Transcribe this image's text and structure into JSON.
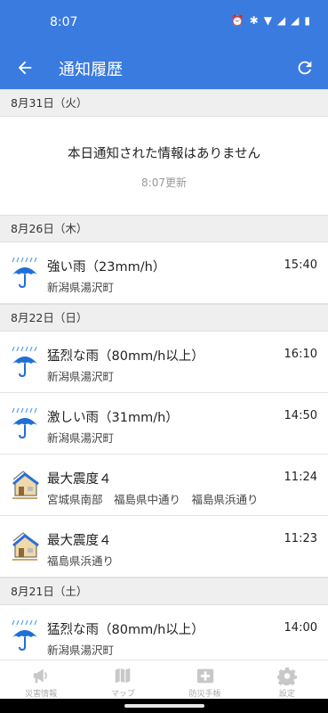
{
  "status_bar": {
    "time": "8:07"
  },
  "app_bar": {
    "title": "通知履歴"
  },
  "sections": [
    {
      "date": "8月31日（火）",
      "empty": {
        "title": "本日通知された情報はありません",
        "updated": "8:07更新"
      }
    },
    {
      "date": "8月26日（木）",
      "items": [
        {
          "type": "rain",
          "title": "強い雨（23mm/h）",
          "area": "新潟県湯沢町",
          "time": "15:40"
        }
      ]
    },
    {
      "date": "8月22日（日）",
      "items": [
        {
          "type": "rain",
          "title": "猛烈な雨（80mm/h以上）",
          "area": "新潟県湯沢町",
          "time": "16:10"
        },
        {
          "type": "rain",
          "title": "激しい雨（31mm/h）",
          "area": "新潟県湯沢町",
          "time": "14:50"
        },
        {
          "type": "quake",
          "title": "最大震度４",
          "area": "宮城県南部　福島県中通り　福島県浜通り",
          "time": "11:24"
        },
        {
          "type": "quake",
          "title": "最大震度４",
          "area": "福島県浜通り",
          "time": "11:23"
        }
      ]
    },
    {
      "date": "8月21日（土）",
      "items": [
        {
          "type": "rain",
          "title": "猛烈な雨（80mm/h以上）",
          "area": "新潟県湯沢町",
          "time": "14:00"
        }
      ]
    }
  ],
  "bottom_nav": [
    {
      "label": "災害情報",
      "icon": "megaphone-icon"
    },
    {
      "label": "マップ",
      "icon": "map-icon"
    },
    {
      "label": "防災手帳",
      "icon": "first-aid-icon"
    },
    {
      "label": "設定",
      "icon": "gear-icon"
    }
  ],
  "colors": {
    "primary": "#3a7be0",
    "header_bg": "#efefef"
  }
}
